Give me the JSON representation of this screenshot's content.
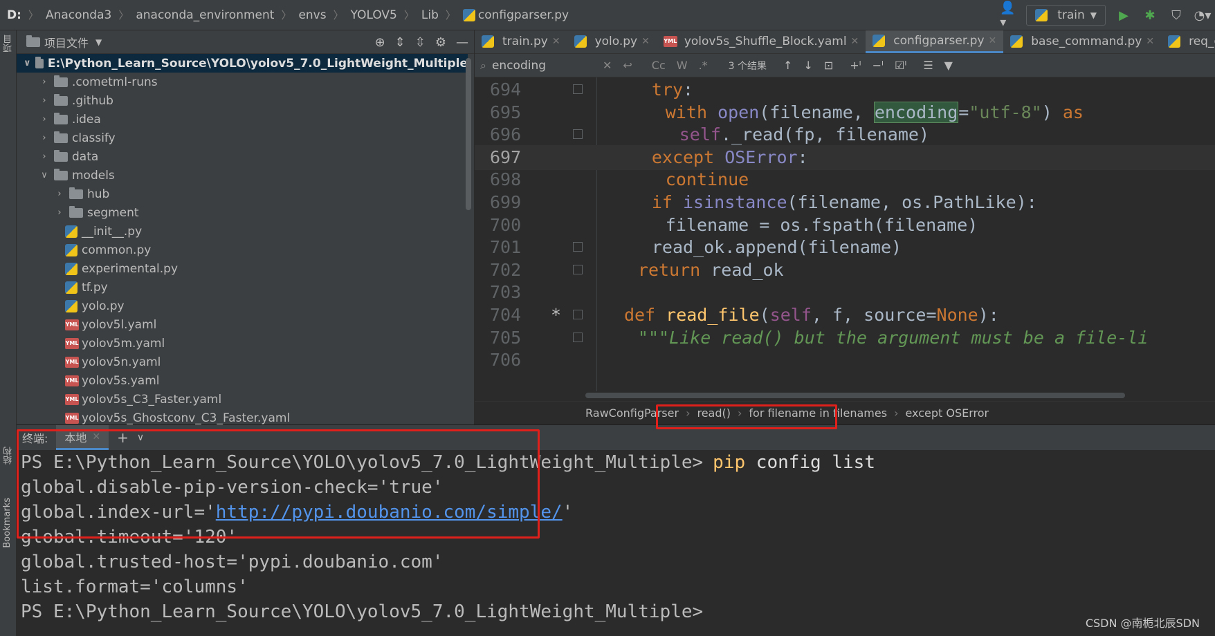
{
  "breadcrumbs": [
    "D:",
    "Anaconda3",
    "anaconda_environment",
    "envs",
    "YOLOV5",
    "Lib",
    "configparser.py"
  ],
  "run_config": "train",
  "left_strip": {
    "project_label": "项目",
    "structure_label": "结构",
    "bookmarks_label": "Bookmarks"
  },
  "project_panel": {
    "title": "项目文件",
    "tree": [
      {
        "label": "E:\\Python_Learn_Source\\YOLO\\yolov5_7.0_LightWeight_Multiple",
        "kind": "folder",
        "depth": 0,
        "expanded": true,
        "selected": true
      },
      {
        "label": ".cometml-runs",
        "kind": "folder",
        "depth": 1,
        "expanded": false
      },
      {
        "label": ".github",
        "kind": "folder",
        "depth": 1,
        "expanded": false
      },
      {
        "label": ".idea",
        "kind": "folder",
        "depth": 1,
        "expanded": false
      },
      {
        "label": "classify",
        "kind": "folder",
        "depth": 1,
        "expanded": false
      },
      {
        "label": "data",
        "kind": "folder",
        "depth": 1,
        "expanded": false
      },
      {
        "label": "models",
        "kind": "folder",
        "depth": 1,
        "expanded": true
      },
      {
        "label": "hub",
        "kind": "folder",
        "depth": 2,
        "expanded": false
      },
      {
        "label": "segment",
        "kind": "folder",
        "depth": 2,
        "expanded": false
      },
      {
        "label": "__init__.py",
        "kind": "py",
        "depth": 2
      },
      {
        "label": "common.py",
        "kind": "py",
        "depth": 2
      },
      {
        "label": "experimental.py",
        "kind": "py",
        "depth": 2
      },
      {
        "label": "tf.py",
        "kind": "py",
        "depth": 2
      },
      {
        "label": "yolo.py",
        "kind": "py",
        "depth": 2
      },
      {
        "label": "yolov5l.yaml",
        "kind": "yml",
        "depth": 2
      },
      {
        "label": "yolov5m.yaml",
        "kind": "yml",
        "depth": 2
      },
      {
        "label": "yolov5n.yaml",
        "kind": "yml",
        "depth": 2
      },
      {
        "label": "yolov5s.yaml",
        "kind": "yml",
        "depth": 2
      },
      {
        "label": "yolov5s_C3_Faster.yaml",
        "kind": "yml",
        "depth": 2
      },
      {
        "label": "yolov5s_Ghostconv_C3_Faster.yaml",
        "kind": "yml",
        "depth": 2
      }
    ]
  },
  "editor_tabs": [
    {
      "label": "train.py",
      "kind": "py",
      "active": false
    },
    {
      "label": "yolo.py",
      "kind": "py",
      "active": false
    },
    {
      "label": "yolov5s_Shuffle_Block.yaml",
      "kind": "yml",
      "active": false
    },
    {
      "label": "configparser.py",
      "kind": "py",
      "active": true
    },
    {
      "label": "base_command.py",
      "kind": "py",
      "active": false
    },
    {
      "label": "req_command.",
      "kind": "py",
      "active": false
    }
  ],
  "search": {
    "value": "encoding",
    "result_count": "3 个结果",
    "match_case": "Cc",
    "words": "W",
    "regex": ".*"
  },
  "code": {
    "current_line": "697",
    "lines": [
      {
        "num": "694",
        "html_parts": [
          [
            "kw",
            "try"
          ],
          [
            "",
            ":"
          ]
        ]
      },
      {
        "num": "695"
      },
      {
        "num": "696"
      },
      {
        "num": "697"
      },
      {
        "num": "698"
      },
      {
        "num": "699"
      },
      {
        "num": "700"
      },
      {
        "num": "701"
      },
      {
        "num": "702"
      },
      {
        "num": "703"
      },
      {
        "num": "704",
        "mark": "*"
      },
      {
        "num": "705"
      },
      {
        "num": "706"
      }
    ]
  },
  "editor_breadcrumbs": [
    "RawConfigParser",
    "read()",
    "for filename in filenames",
    "except OSError"
  ],
  "terminal": {
    "label": "终端:",
    "tab_label": "本地",
    "prompt": "PS E:\\Python_Learn_Source\\YOLO\\yolov5_7.0_LightWeight_Multiple>",
    "command_name": "pip",
    "command_args": " config list",
    "output": [
      {
        "prefix": "global.disable-pip-version-check='true'"
      },
      {
        "prefix": "global.index-url='",
        "link": "http://pypi.doubanio.com/simple/",
        "suffix": "'"
      },
      {
        "prefix": "global.timeout='120'"
      },
      {
        "prefix": "global.trusted-host='pypi.doubanio.com'"
      },
      {
        "prefix": "list.format='columns'"
      }
    ]
  },
  "watermark": "CSDN @南栀北辰SDN",
  "colors": {
    "selection": "#0d293e",
    "keyword": "#cc7832",
    "string": "#6a8759",
    "highlight_box": "#e0201a",
    "link": "#5394ec"
  }
}
